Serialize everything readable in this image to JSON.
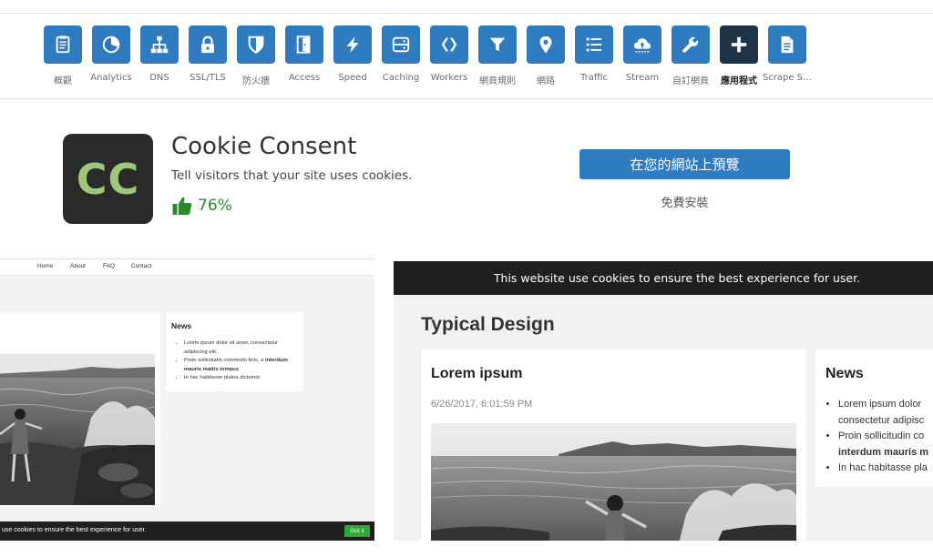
{
  "nav": {
    "items": [
      {
        "label": "概觀",
        "icon": "overview-icon"
      },
      {
        "label": "Analytics",
        "icon": "analytics-icon"
      },
      {
        "label": "DNS",
        "icon": "dns-icon"
      },
      {
        "label": "SSL/TLS",
        "icon": "lock-icon"
      },
      {
        "label": "防火牆",
        "icon": "shield-icon"
      },
      {
        "label": "Access",
        "icon": "door-icon"
      },
      {
        "label": "Speed",
        "icon": "lightning-icon"
      },
      {
        "label": "Caching",
        "icon": "storage-icon"
      },
      {
        "label": "Workers",
        "icon": "workers-icon"
      },
      {
        "label": "網頁規則",
        "icon": "filter-icon"
      },
      {
        "label": "網路",
        "icon": "location-pin-icon"
      },
      {
        "label": "Traffic",
        "icon": "list-icon"
      },
      {
        "label": "Stream",
        "icon": "cloud-upload-icon"
      },
      {
        "label": "自訂網頁",
        "icon": "wrench-icon"
      },
      {
        "label": "應用程式",
        "icon": "plus-icon"
      },
      {
        "label": "Scrape S…",
        "icon": "document-icon"
      }
    ],
    "active_index": 14
  },
  "app": {
    "logo_text": "CC",
    "title": "Cookie Consent",
    "description": "Tell visitors that your site uses cookies.",
    "rating": "76%",
    "preview_button": "在您的網站上預覽",
    "install_text": "免費安裝"
  },
  "shot_left": {
    "nav": [
      "Home",
      "About",
      "FAQ",
      "Contact"
    ],
    "news_title": "News",
    "news_items": [
      "Lorem ipsum dolor sit amet, consectetur adipiscing elit.",
      "Proin sollicitudin commodo felis, a",
      "In hac habitasse platea dictumst."
    ],
    "news_item2_bold": "interdum mauris mattis tempus",
    "cookie_bar": "use cookies to ensure the best experience for user.",
    "cookie_button": "Got it"
  },
  "shot_right": {
    "cookie_bar": "This website use cookies to ensure the best experience for user.",
    "heading": "Typical Design",
    "card_title": "Lorem ipsum",
    "card_date": "6/26/2017, 6:01:59 PM",
    "news_title": "News",
    "news_lines": [
      "Lorem ipsum dolor",
      "consectetur adipisc",
      "Proin sollicitudin co",
      "interdum mauris m",
      "In hac habitasse pla"
    ]
  },
  "colors": {
    "tile": "#2f7bbf",
    "tile_active": "#1f3347",
    "logo_bg": "#2a2a2a",
    "logo_text": "#9dc87a",
    "rating": "#2b8a2b",
    "cookie_button": "#2eaa2e"
  }
}
